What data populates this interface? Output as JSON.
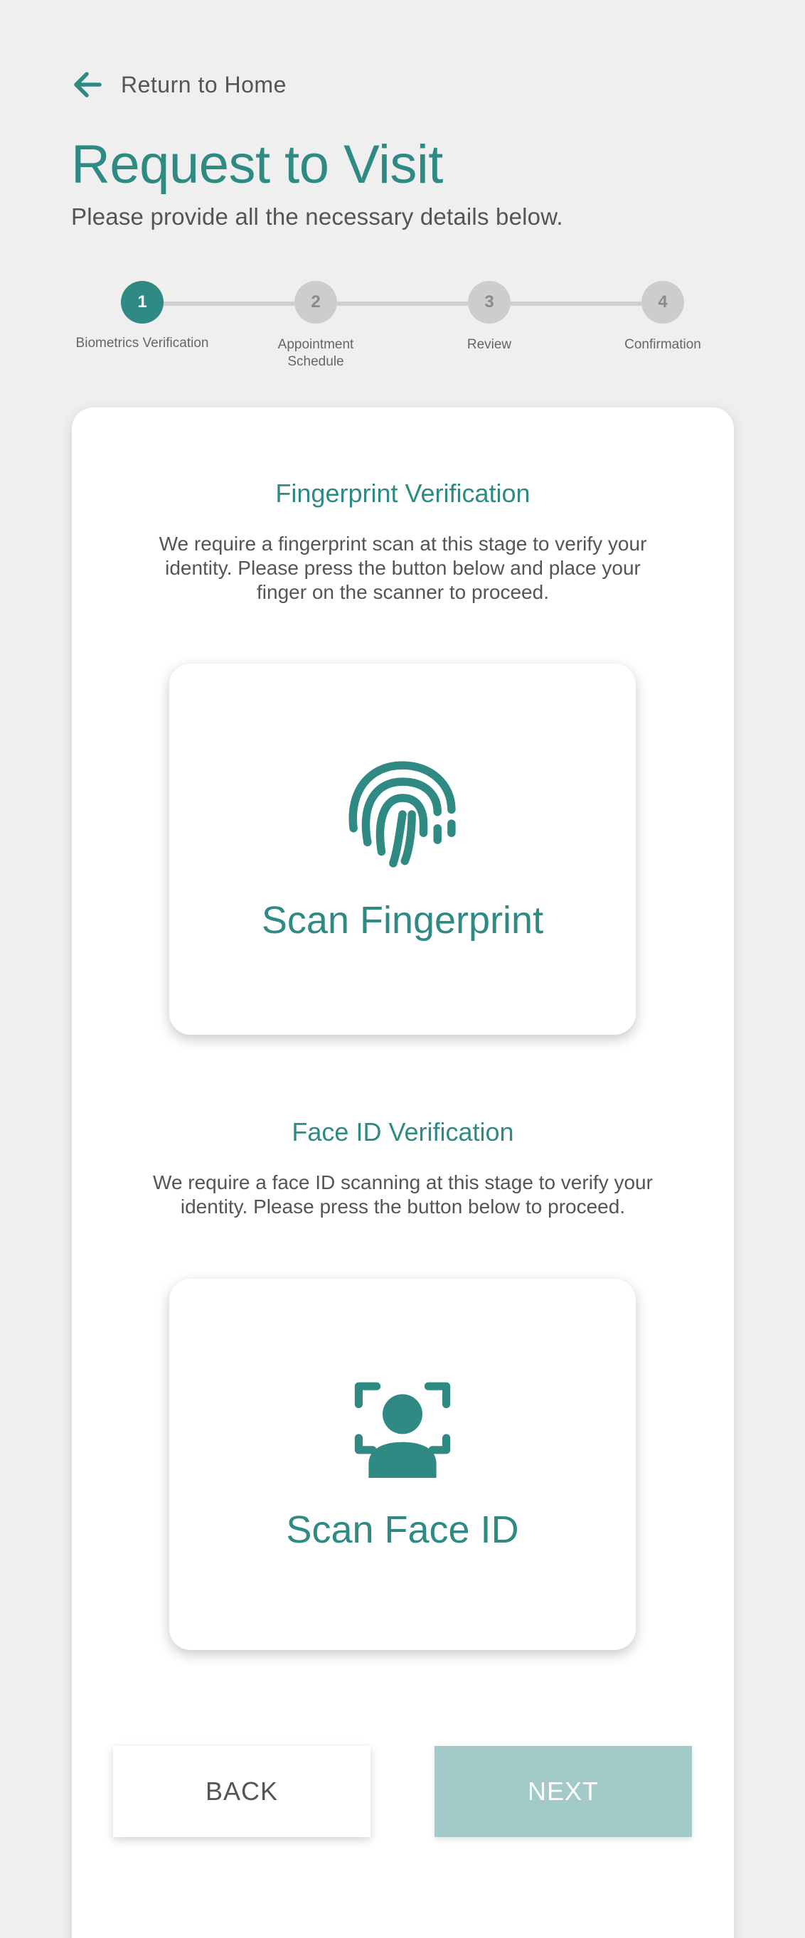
{
  "header": {
    "back_link_label": "Return to Home",
    "title": "Request to Visit",
    "subtitle": "Please provide all the necessary details below."
  },
  "stepper": {
    "current_step": 1,
    "steps": [
      {
        "number": "1",
        "label": "Biometrics Verification"
      },
      {
        "number": "2",
        "label": "Appointment Schedule"
      },
      {
        "number": "3",
        "label": "Review"
      },
      {
        "number": "4",
        "label": "Confirmation"
      }
    ]
  },
  "fingerprint": {
    "title": "Fingerprint Verification",
    "description": "We require a fingerprint scan at this stage to verify your identity. Please press the button below and place your finger on the scanner to proceed.",
    "button_label": "Scan Fingerprint",
    "icon": "fingerprint-icon"
  },
  "face_id": {
    "title": "Face ID Verification",
    "description": "We require a face ID scanning at this stage to verify your identity. Please press the button below to proceed.",
    "button_label": "Scan Face ID",
    "icon": "face-scan-icon"
  },
  "actions": {
    "back_label": "BACK",
    "next_label": "NEXT"
  },
  "colors": {
    "accent": "#2e8a83",
    "next_disabled": "#a2cbc8",
    "background": "#efefef"
  }
}
